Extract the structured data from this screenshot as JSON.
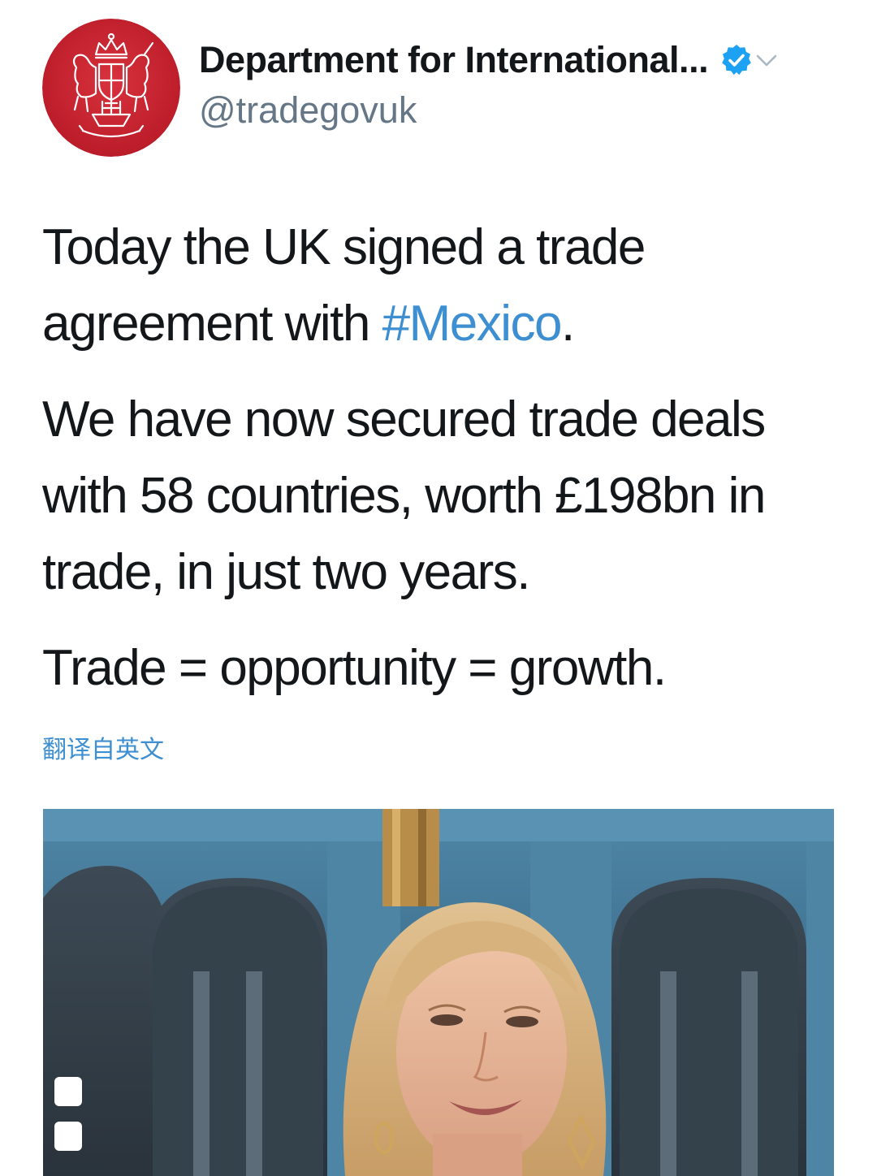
{
  "tweet": {
    "author": {
      "display_name": "Department for International...",
      "handle": "@tradegovuk",
      "verified": true,
      "avatar_icon": "royal-crest-icon",
      "avatar_color": "#c8202e"
    },
    "paragraphs": {
      "p1_before": "Today the UK signed a trade agreement with ",
      "p1_hashtag": "#Mexico",
      "p1_after": ".",
      "p2": "We have now secured trade deals with 58 countries, worth £198bn in trade, in just two years.",
      "p3": "Trade = opportunity = growth."
    },
    "translate_label": "翻译自英文",
    "media": {
      "type": "video-thumbnail"
    }
  },
  "colors": {
    "text": "#14171a",
    "secondary": "#657786",
    "link": "#3d8fd1",
    "verified_badge": "#1da1f2"
  },
  "icons": {
    "verified": "verified-badge-icon",
    "menu": "chevron-down-icon"
  }
}
